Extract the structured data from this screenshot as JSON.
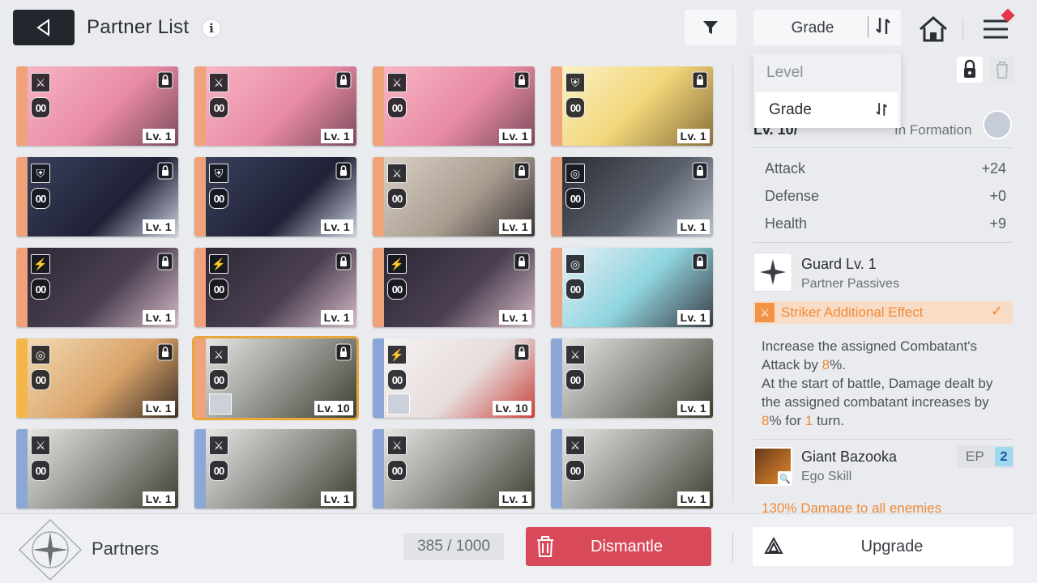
{
  "header": {
    "title": "Partner List",
    "info_icon": "i",
    "sort_label": "Grade",
    "icons": [
      "back-arrow-icon",
      "filter-icon",
      "sort-order-icon",
      "home-icon",
      "menu-icon"
    ]
  },
  "sort_dropdown": {
    "options": [
      "Level",
      "Grade"
    ],
    "selected": "Grade"
  },
  "cards": [
    {
      "cls": "⚔",
      "oo": "00",
      "level": "Lv. 1",
      "locked": true,
      "strip": "#f0a27a",
      "art": "linear-gradient(135deg,#f7b5c4,#e88aa4 55%,#7a4b5a)"
    },
    {
      "cls": "⚔",
      "oo": "00",
      "level": "Lv. 1",
      "locked": true,
      "strip": "#f0a27a",
      "art": "linear-gradient(135deg,#f7b5c4,#e88aa4 55%,#7a4b5a)"
    },
    {
      "cls": "⚔",
      "oo": "00",
      "level": "Lv. 1",
      "locked": true,
      "strip": "#f0a27a",
      "art": "linear-gradient(135deg,#f7b5c4,#e88aa4 55%,#7a4b5a)"
    },
    {
      "cls": "⛨",
      "oo": "00",
      "level": "Lv. 1",
      "locked": true,
      "strip": "#f0a27a",
      "art": "linear-gradient(135deg,#fbf1c6,#f1d67a 50%,#8a6e3a)"
    },
    {
      "cls": "⛨",
      "oo": "00",
      "level": "Lv. 1",
      "locked": true,
      "strip": "#f0a27a",
      "art": "linear-gradient(135deg,#3a3f5c,#1f2236 60%,#cfd3e0)"
    },
    {
      "cls": "⛨",
      "oo": "00",
      "level": "Lv. 1",
      "locked": true,
      "strip": "#f0a27a",
      "art": "linear-gradient(135deg,#3a3f5c,#1f2236 60%,#cfd3e0)"
    },
    {
      "cls": "⚔",
      "oo": "00",
      "level": "Lv. 1",
      "locked": true,
      "strip": "#f0a27a",
      "art": "linear-gradient(135deg,#d9cfc4,#a99d90 55%,#3a3436)"
    },
    {
      "cls": "◎",
      "oo": "00",
      "level": "Lv. 1",
      "locked": true,
      "strip": "#f0a27a",
      "art": "linear-gradient(135deg,#2a2d34,#5a606b 55%,#b9c0cb)"
    },
    {
      "cls": "⚡",
      "oo": "00",
      "level": "Lv. 1",
      "locked": true,
      "strip": "#f0a27a",
      "art": "linear-gradient(135deg,#2d2836,#4b4052 55%,#d6b9c6)"
    },
    {
      "cls": "⚡",
      "oo": "00",
      "level": "Lv. 1",
      "locked": true,
      "strip": "#f0a27a",
      "art": "linear-gradient(135deg,#2d2836,#4b4052 55%,#d6b9c6)"
    },
    {
      "cls": "⚡",
      "oo": "00",
      "level": "Lv. 1",
      "locked": true,
      "strip": "#f0a27a",
      "art": "linear-gradient(135deg,#2d2836,#4b4052 55%,#d6b9c6)"
    },
    {
      "cls": "◎",
      "oo": "00",
      "level": "Lv. 1",
      "locked": true,
      "strip": "#f0a27a",
      "art": "linear-gradient(135deg,#e8eef4,#8fd6e0 50%,#3a3c44)"
    },
    {
      "cls": "◎",
      "oo": "00",
      "level": "Lv. 1",
      "locked": true,
      "strip": "#f4b64a",
      "art": "linear-gradient(135deg,#f2d9b2,#d9a36a 55%,#3b2e22)"
    },
    {
      "cls": "⚔",
      "oo": "00",
      "level": "Lv. 10",
      "locked": true,
      "strip": "#f0a27a",
      "art": "linear-gradient(135deg,#e6e6e4,#8c8f88 55%,#3b4030)",
      "selected": true,
      "mini": true
    },
    {
      "cls": "⚡",
      "oo": "00",
      "level": "Lv. 10",
      "locked": true,
      "strip": "#8aa7d6",
      "art": "linear-gradient(135deg,#f5f3f1,#e7dcdc 55%,#c9413b)",
      "mini": true
    },
    {
      "cls": "⚔",
      "oo": "00",
      "level": "Lv. 1",
      "locked": false,
      "strip": "#8aa7d6",
      "art": "linear-gradient(135deg,#e6e6e4,#8c8f88 55%,#3b4030)"
    },
    {
      "cls": "⚔",
      "oo": "00",
      "level": "Lv. 1",
      "locked": false,
      "strip": "#8aa7d6",
      "art": "linear-gradient(135deg,#e6e6e4,#8c8f88 55%,#3b4030)"
    },
    {
      "cls": "⚔",
      "oo": "00",
      "level": "Lv. 1",
      "locked": false,
      "strip": "#8aa7d6",
      "art": "linear-gradient(135deg,#e6e6e4,#8c8f88 55%,#3b4030)"
    },
    {
      "cls": "⚔",
      "oo": "00",
      "level": "Lv. 1",
      "locked": false,
      "strip": "#8aa7d6",
      "art": "linear-gradient(135deg,#e6e6e4,#8c8f88 55%,#3b4030)"
    },
    {
      "cls": "⚔",
      "oo": "00",
      "level": "Lv. 1",
      "locked": false,
      "strip": "#8aa7d6",
      "art": "linear-gradient(135deg,#e6e6e4,#8c8f88 55%,#3b4030)"
    }
  ],
  "details": {
    "level_text": "Lv. 10/",
    "formation_text": "In Formation",
    "stats": [
      {
        "label": "Attack",
        "value": "+24"
      },
      {
        "label": "Defense",
        "value": "+0"
      },
      {
        "label": "Health",
        "value": "+9"
      }
    ],
    "passive": {
      "name": "Guard Lv. 1",
      "type": "Partner Passives"
    },
    "striker_label": "Striker Additional Effect",
    "description": {
      "p1_a": "Increase the assigned Combatant's Attack by ",
      "p1_num": "8",
      "p1_b": "%.",
      "p2_a": "At the start of battle, Damage dealt by the assigned combatant increases by ",
      "p2_num": "8",
      "p2_b": "% for ",
      "p2_num2": "1",
      "p2_c": " turn."
    },
    "skill": {
      "name": "Giant Bazooka",
      "type": "Ego Skill",
      "ep_label": "EP",
      "ep_value": "2"
    },
    "cutoff_text": "130% Damage to all enemies"
  },
  "bottom": {
    "partners_label": "Partners",
    "count": "385",
    "capacity": "1000",
    "dismantle_label": "Dismantle",
    "upgrade_label": "Upgrade"
  },
  "colors": {
    "accent": "#f08a38",
    "dismantle": "#d84a5a",
    "selected_border": "#e9a63a"
  }
}
